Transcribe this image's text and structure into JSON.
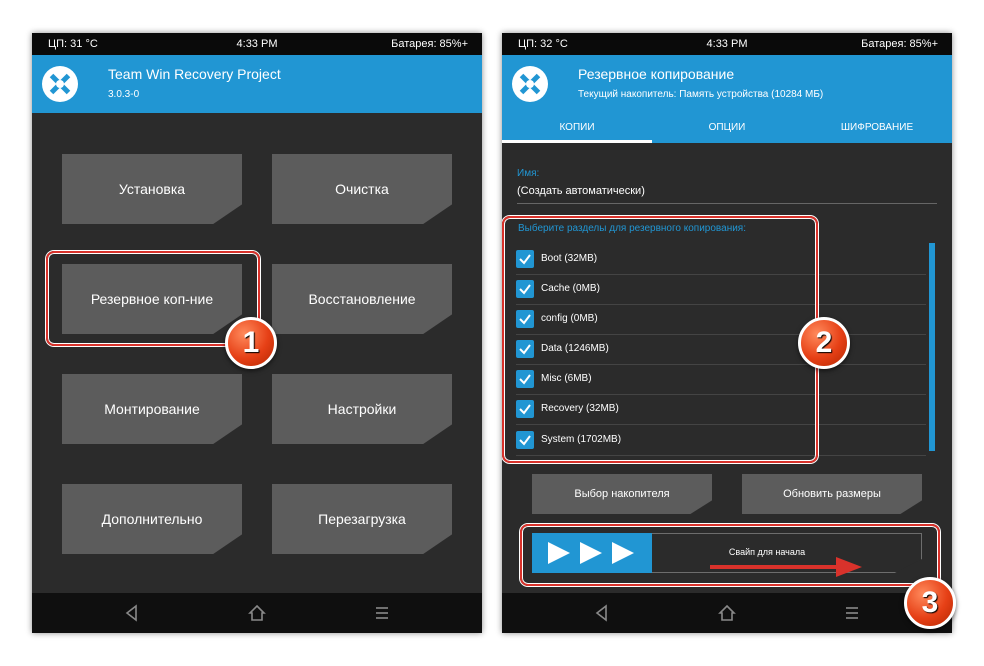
{
  "colors": {
    "accent": "#2196d3",
    "screen_bg": "#2b2b2b",
    "button_bg": "#5c5c5c",
    "highlight": "#d9322b",
    "marker": "#e64016"
  },
  "left": {
    "status": {
      "cpu": "ЦП: 31 °C",
      "time": "4:33 PM",
      "battery": "Батарея: 85%+"
    },
    "header": {
      "title": "Team Win Recovery Project",
      "subtitle": "3.0.3-0",
      "logo_icon": "twrp-logo-icon"
    },
    "menu": [
      {
        "label": "Установка"
      },
      {
        "label": "Очистка"
      },
      {
        "label": "Резервное коп-ние"
      },
      {
        "label": "Восстановление"
      },
      {
        "label": "Монтирование"
      },
      {
        "label": "Настройки"
      },
      {
        "label": "Дополнительно"
      },
      {
        "label": "Перезагрузка"
      }
    ],
    "marker": "1",
    "nav": [
      "back-icon",
      "home-icon",
      "menu-icon"
    ]
  },
  "right": {
    "status": {
      "cpu": "ЦП: 32 °C",
      "time": "4:33 PM",
      "battery": "Батарея: 85%+"
    },
    "header": {
      "title": "Резервное копирование",
      "subtitle": "Текущий накопитель: Память устройства (10284 МБ)",
      "logo_icon": "twrp-logo-icon"
    },
    "tabs": [
      "КОПИИ",
      "ОПЦИИ",
      "ШИФРОВАНИЕ"
    ],
    "name_label": "Имя:",
    "name_value": "(Создать автоматически)",
    "partitions_title": "Выберите разделы для резервного копирования:",
    "partitions": [
      {
        "label": "Boot (32MB)",
        "checked": true
      },
      {
        "label": "Cache (0MB)",
        "checked": true
      },
      {
        "label": "config (0MB)",
        "checked": true
      },
      {
        "label": "Data (1246MB)",
        "checked": true
      },
      {
        "label": "Misc (6MB)",
        "checked": true
      },
      {
        "label": "Recovery (32MB)",
        "checked": true
      },
      {
        "label": "System (1702MB)",
        "checked": true
      }
    ],
    "buttons": {
      "storage": "Выбор накопителя",
      "refresh": "Обновить размеры"
    },
    "swipe": "Свайп для начала",
    "markers": [
      "2",
      "3"
    ],
    "nav": [
      "back-icon",
      "home-icon",
      "menu-icon"
    ]
  }
}
